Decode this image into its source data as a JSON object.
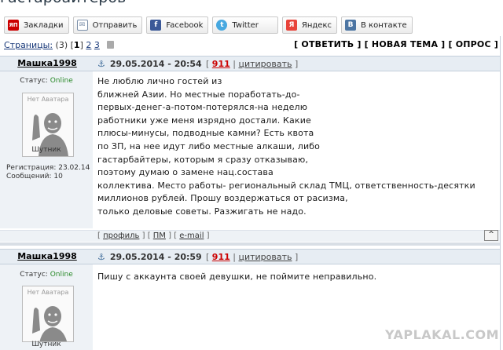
{
  "thread_title": "гастарбайтеров",
  "share_buttons": [
    {
      "label": "Закладки",
      "icon": "yap-icon",
      "color": "#cc0000",
      "glyph": "ЯП"
    },
    {
      "label": "Отправить",
      "icon": "mail-icon",
      "color": "#7a8ea8",
      "glyph": "✉"
    },
    {
      "label": "Facebook",
      "icon": "facebook-icon",
      "color": "#3b5998",
      "glyph": "f"
    },
    {
      "label": "Twitter",
      "icon": "twitter-icon",
      "color": "#47a8e0",
      "glyph": "t"
    },
    {
      "label": "Яндекс",
      "icon": "yandex-icon",
      "color": "#e8433a",
      "glyph": "Я"
    },
    {
      "label": "В контакте",
      "icon": "vk-icon",
      "color": "#4c75a3",
      "glyph": "B"
    }
  ],
  "pagination": {
    "label": "Страницы:",
    "total": "(3)",
    "current": "1",
    "pages": [
      "2",
      "3"
    ]
  },
  "actions": "[ ОТВЕТИТЬ ] [ НОВАЯ ТЕМА ] [ ОПРОС ]",
  "posts": [
    {
      "username": "Машка1998",
      "date": "29.05.2014 - 20:54",
      "rating": "911",
      "quote_label": "цитировать",
      "status_label": "Статус:",
      "status_value": "Online",
      "avatar_text": "Нет Аватара",
      "rank": "Шутник",
      "reg_label": "Регистрация: 23.02.14",
      "posts_label": "Сообщений: 10",
      "lines": [
        "Не люблю лично гостей из",
        "ближней Азии. Но местные поработать-до-",
        "первых-денег-а-потом-потерялся-на неделю",
        "работники уже меня изрядно достали. Какие",
        "плюсы-минусы, подводные камни? Есть квота",
        "по ЗП, на нее идут либо местные алкаши, либо",
        "гастарбайтеры, которым я сразу отказываю,",
        "поэтому думаю о замене нац.состава",
        "коллектива. Место работы- региональный склад ТМЦ, ответственность-десятки",
        "миллионов рублей. Прошу воздержаться от расизма,",
        "только деловые советы. Разжигать не надо."
      ],
      "footer_links": [
        "профиль",
        "ПМ",
        "e-mail"
      ],
      "up_label": "^"
    },
    {
      "username": "Машка1998",
      "date": "29.05.2014 - 20:59",
      "rating": "911",
      "quote_label": "цитировать",
      "status_label": "Статус:",
      "status_value": "Online",
      "avatar_text": "Нет Аватара",
      "rank": "Шутник",
      "lines": [
        "Пишу с аккаунта своей девушки, не поймите неправильно."
      ]
    }
  ],
  "watermark": "YAPLAKAL.COM"
}
